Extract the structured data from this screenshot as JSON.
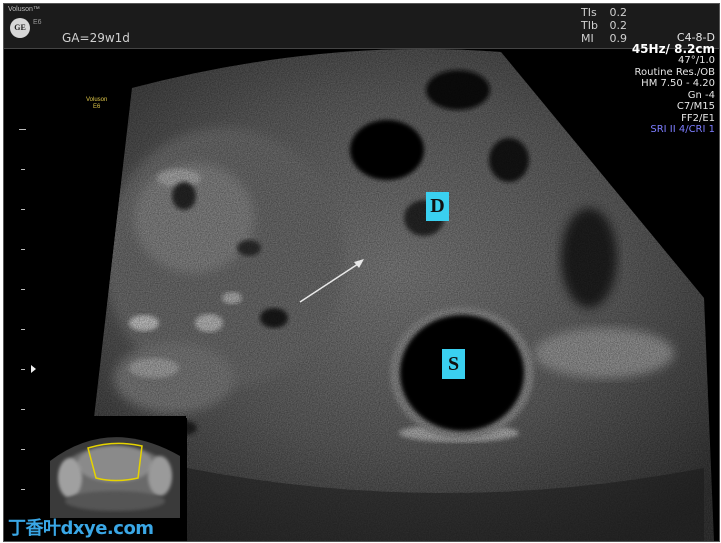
{
  "header": {
    "brand": "Voluson™",
    "logo": "GE",
    "model_small": "E6",
    "gestational_age": "GA=29w1d",
    "indices": [
      {
        "label": "TIs",
        "value": "0.2"
      },
      {
        "label": "TIb",
        "value": "0.2"
      },
      {
        "label": "MI",
        "value": "0.9"
      }
    ]
  },
  "params": {
    "probe": "C4-8-D",
    "frequency": "45Hz/ 8.2cm",
    "angle": "47°/1.0",
    "preset": "Routine Res./OB",
    "harmonic": "HM  7.50 - 4.20",
    "gain": "Gn  -4",
    "contrast": "C7/M15",
    "filter": "FF2/E1",
    "sri": "SRI II 4/CRI 1"
  },
  "image_label": {
    "brand": "Voluson",
    "model": "E6"
  },
  "annotations": {
    "d_label": "D",
    "s_label": "S",
    "arrow_icon": "arrow-pointer-icon"
  },
  "watermark": {
    "cn": "丁香叶",
    "en": "dxye.com"
  },
  "colors": {
    "label_bg": "#3ad0f0",
    "sri_text": "#7d7dff",
    "watermark": "#3aa7e6",
    "thumb_roi": "#e6d300"
  }
}
